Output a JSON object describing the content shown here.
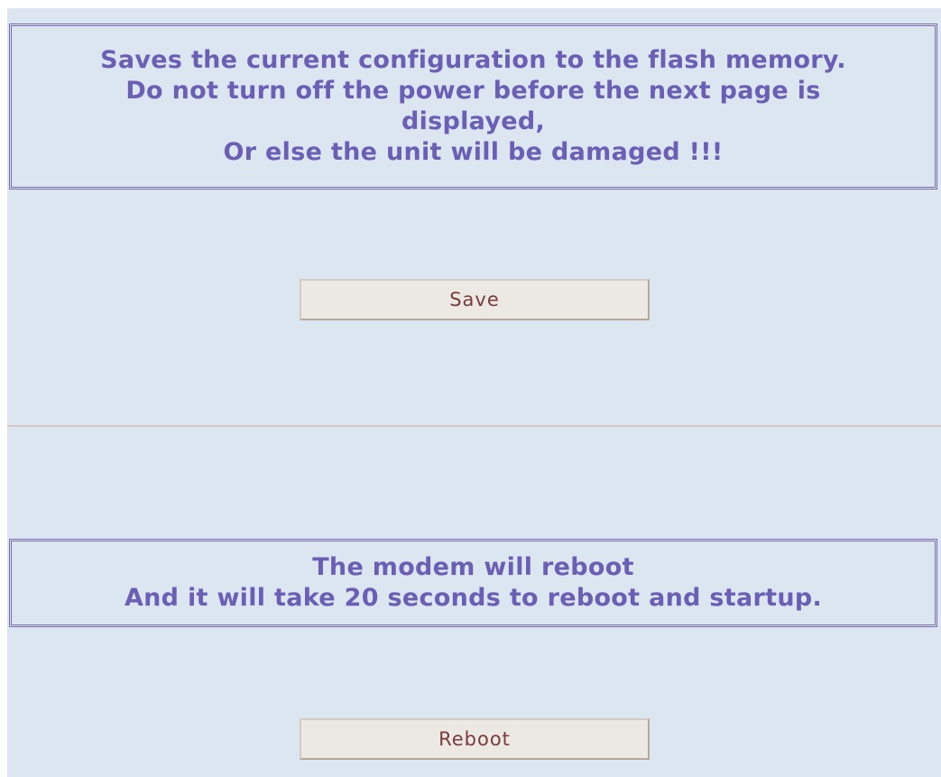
{
  "save_section": {
    "notice_lines": [
      "Saves the current configuration to the flash memory.",
      "Do not turn off the power before the next page is",
      "displayed,",
      "Or else the unit will be damaged !!!"
    ],
    "button_label": "Save"
  },
  "reboot_section": {
    "notice_lines": [
      "The modem will reboot",
      "And it will take 20 seconds to reboot and startup."
    ],
    "button_label": "Reboot"
  },
  "colors": {
    "background": "#dce6f0",
    "notice_text": "#6a5fb5",
    "notice_border": "#7a6bb0",
    "button_face": "#ece9e4",
    "button_text": "#7a3b3b",
    "divider": "#d9c7bf"
  }
}
